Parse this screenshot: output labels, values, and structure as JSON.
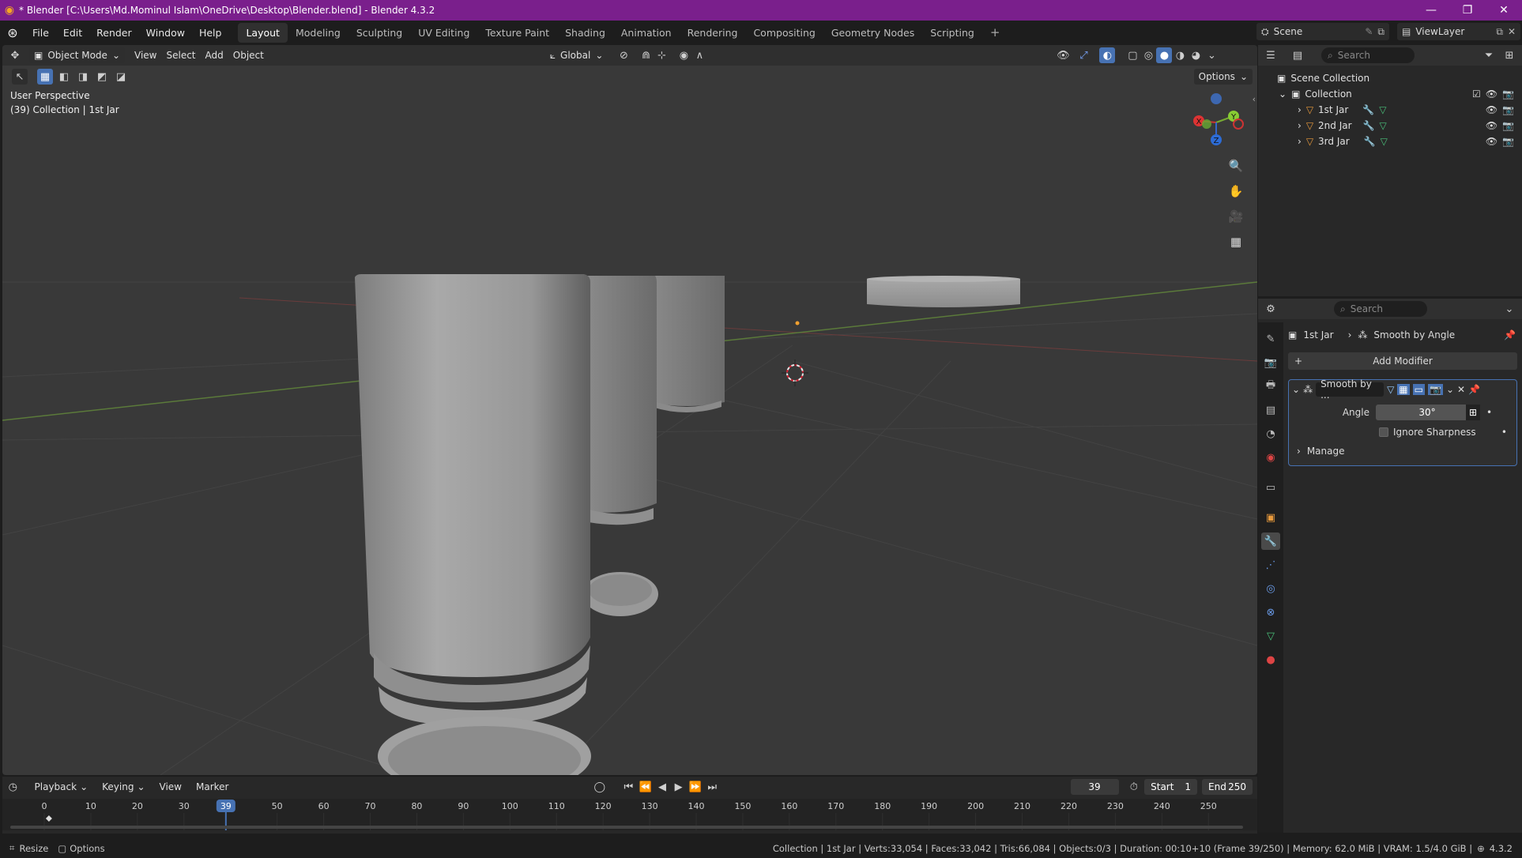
{
  "window": {
    "title": "* Blender [C:\\Users\\Md.Mominul Islam\\OneDrive\\Desktop\\Blender.blend] - Blender 4.3.2"
  },
  "menu": [
    "File",
    "Edit",
    "Render",
    "Window",
    "Help"
  ],
  "workspaces": [
    "Layout",
    "Modeling",
    "Sculpting",
    "UV Editing",
    "Texture Paint",
    "Shading",
    "Animation",
    "Rendering",
    "Compositing",
    "Geometry Nodes",
    "Scripting"
  ],
  "active_workspace": "Layout",
  "scene": {
    "name": "Scene",
    "view_layer": "ViewLayer"
  },
  "viewport": {
    "mode": "Object Mode",
    "menus": [
      "View",
      "Select",
      "Add",
      "Object"
    ],
    "orientation": "Global",
    "options": "Options",
    "info_line1": "User Perspective",
    "info_line2": "(39) Collection | 1st Jar",
    "axes": {
      "x": "X",
      "y": "Y",
      "z": "Z"
    }
  },
  "outliner": {
    "search_placeholder": "Search",
    "root": "Scene Collection",
    "collection": "Collection",
    "objects": [
      "1st Jar",
      "2nd Jar",
      "3rd Jar"
    ]
  },
  "properties": {
    "search_placeholder": "Search",
    "breadcrumb_object": "1st Jar",
    "breadcrumb_modifier": "Smooth by Angle",
    "add_modifier": "Add Modifier",
    "modifier_name": "Smooth by ...",
    "angle_label": "Angle",
    "angle_value": "30°",
    "ignore_sharpness": "Ignore Sharpness",
    "manage": "Manage"
  },
  "timeline": {
    "menus": [
      "Playback",
      "Keying",
      "View",
      "Marker"
    ],
    "current_frame": "39",
    "start_label": "Start",
    "start": "1",
    "end_label": "End",
    "end": "250",
    "ticks": [
      "0",
      "10",
      "20",
      "30",
      "50",
      "60",
      "70",
      "80",
      "90",
      "100",
      "110",
      "120",
      "130",
      "140",
      "150",
      "160",
      "170",
      "180",
      "190",
      "200",
      "210",
      "220",
      "230",
      "240",
      "250"
    ]
  },
  "status": {
    "left1": "Resize",
    "left2": "Options",
    "stats": "Collection | 1st Jar | Verts:33,054 | Faces:33,042 | Tris:66,084 | Objects:0/3 | Duration: 00:10+10 (Frame 39/250) | Memory: 62.0 MiB | VRAM: 1.5/4.0 GiB |",
    "version": "4.3.2"
  },
  "colors": {
    "title_bar": "#7a1f8c",
    "accent": "#4772b3",
    "viewport_bg": "#393939"
  }
}
